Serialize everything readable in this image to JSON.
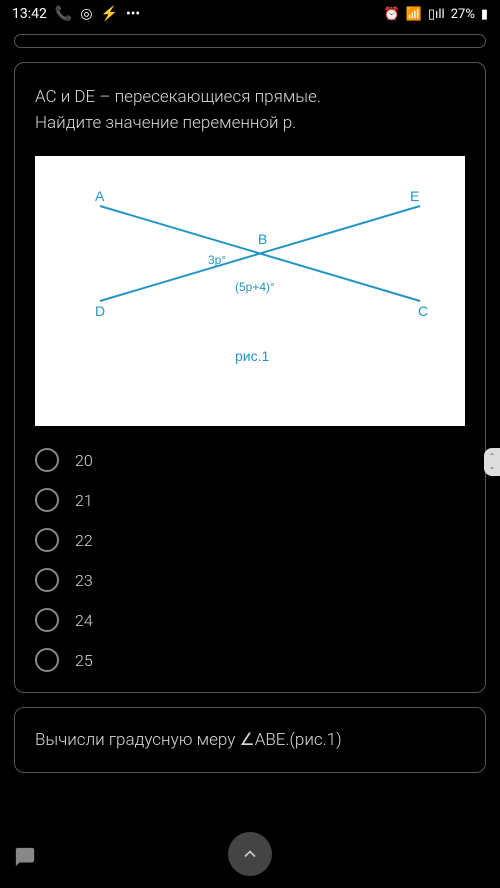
{
  "status": {
    "time": "13:42",
    "battery": "27%"
  },
  "question": {
    "line1": "АС и DE – пересекающиеся прямые.",
    "line2": "Найдите значение переменной р."
  },
  "diagram": {
    "point_a": "A",
    "point_b": "B",
    "point_c": "C",
    "point_d": "D",
    "point_e": "E",
    "angle1": "3p°",
    "angle2": "(5p+4)°",
    "caption": "рис.1"
  },
  "options": [
    "20",
    "21",
    "22",
    "23",
    "24",
    "25"
  ],
  "next_question": "Вычисли градусную меру ∠АВЕ.(рис.1)"
}
